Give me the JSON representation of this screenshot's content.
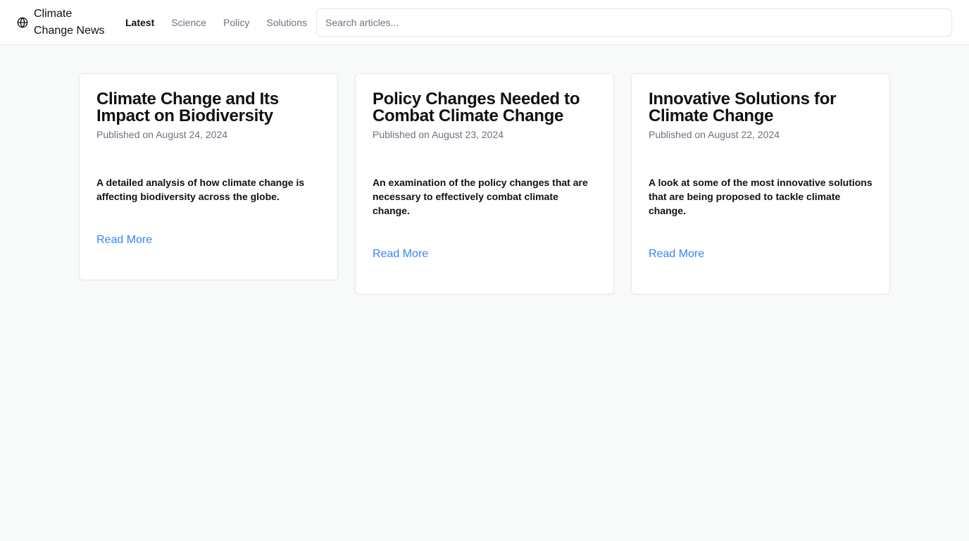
{
  "header": {
    "brand_icon": "globe-icon",
    "brand_name": "Climate Change News",
    "nav": [
      {
        "label": "Latest",
        "active": true
      },
      {
        "label": "Science",
        "active": false
      },
      {
        "label": "Policy",
        "active": false
      },
      {
        "label": "Solutions",
        "active": false
      }
    ],
    "search": {
      "placeholder": "Search articles...",
      "value": ""
    }
  },
  "articles": [
    {
      "title": "Climate Change and Its Impact on Biodiversity",
      "date": "Published on August 24, 2024",
      "summary": "A detailed analysis of how climate change is affecting biodiversity across the globe.",
      "link_label": "Read More"
    },
    {
      "title": "Policy Changes Needed to Combat Climate Change",
      "date": "Published on August 23, 2024",
      "summary": "An examination of the policy changes that are necessary to effectively combat climate change.",
      "link_label": "Read More"
    },
    {
      "title": "Innovative Solutions for Climate Change",
      "date": "Published on August 22, 2024",
      "summary": "A look at some of the most innovative solutions that are being proposed to tackle climate change.",
      "link_label": "Read More"
    }
  ],
  "colors": {
    "link": "#3b82f6",
    "muted_text": "#6b7280",
    "background": "#f8faf9"
  }
}
